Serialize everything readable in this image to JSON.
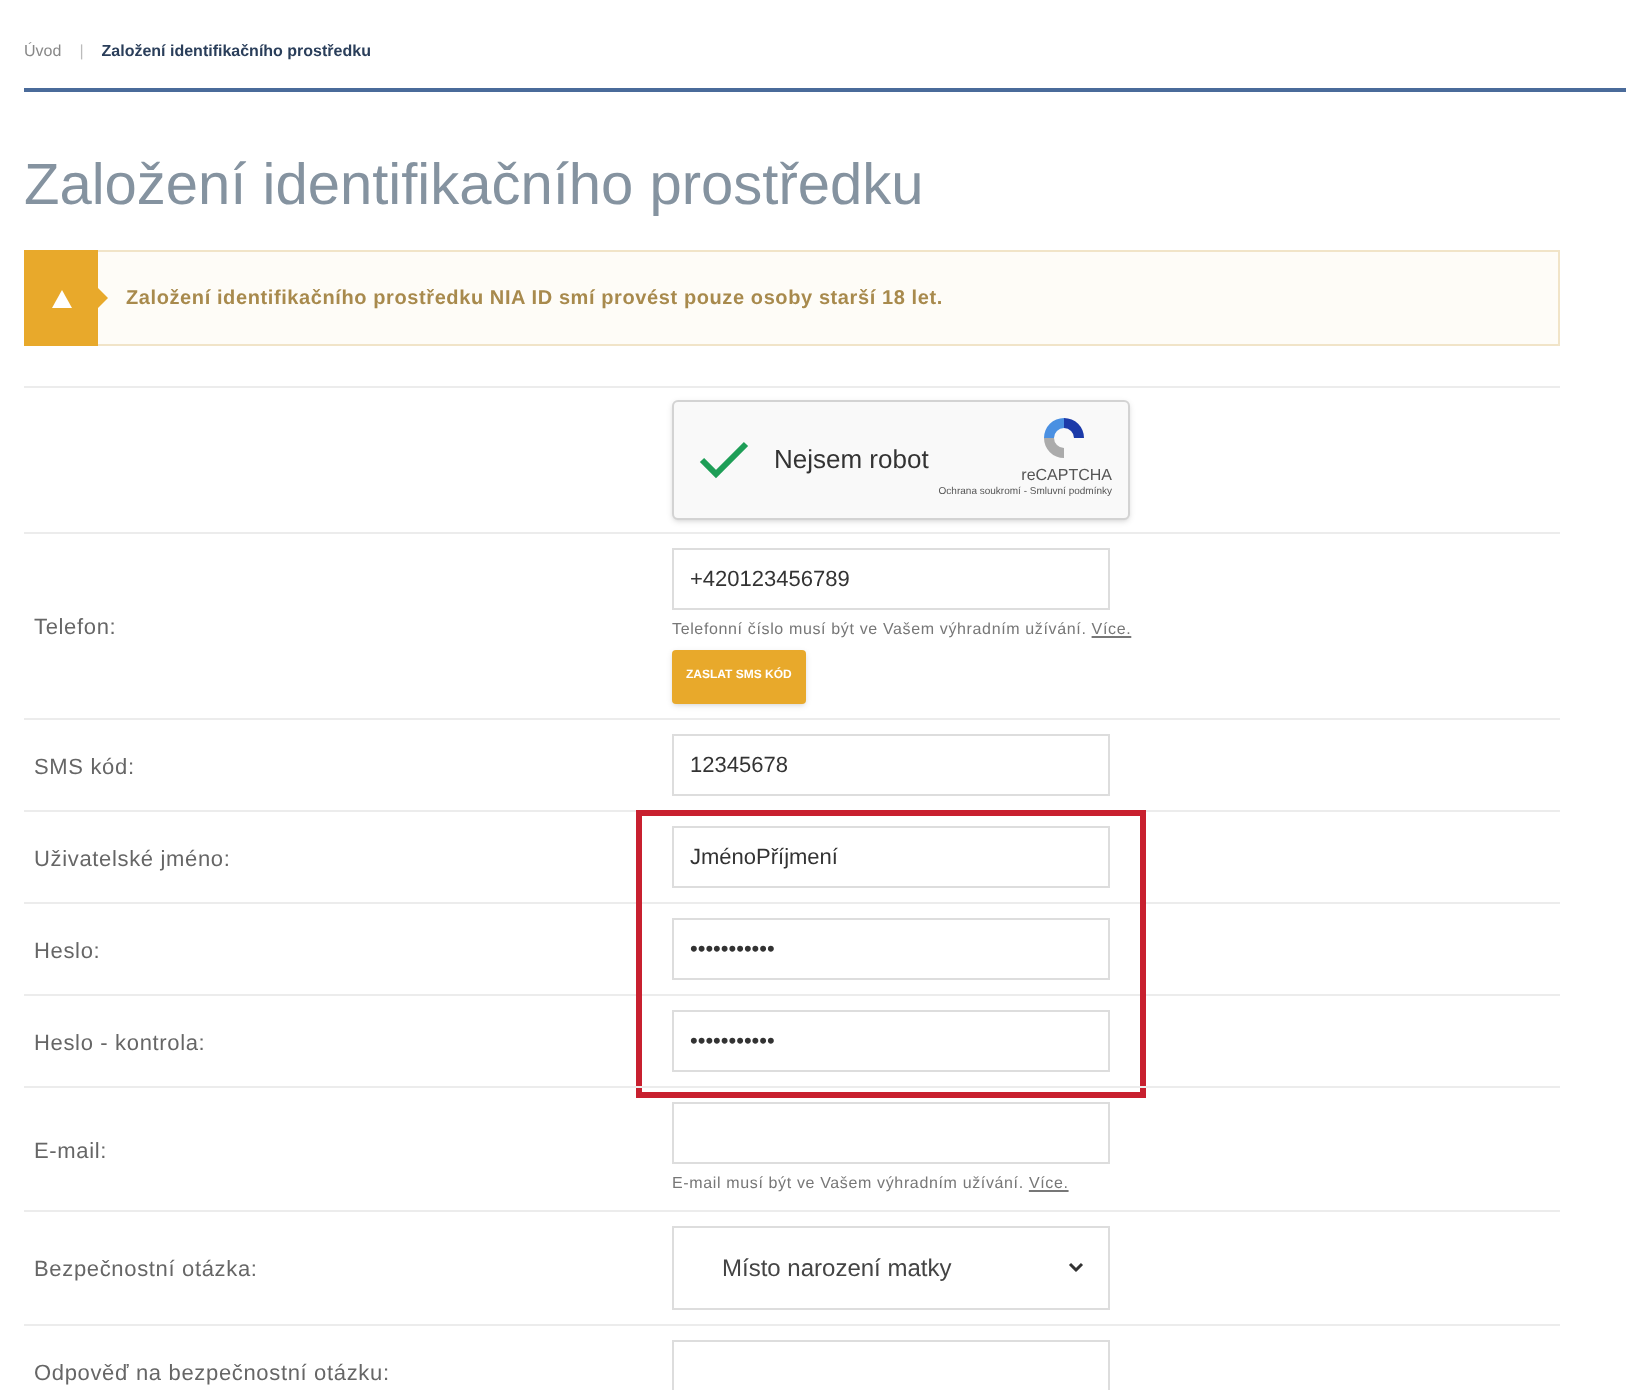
{
  "breadcrumb": [
    {
      "label": "Úvod",
      "selected": false
    },
    {
      "label": "Založení identifikačního prostředku",
      "selected": true
    }
  ],
  "breadcrumb_separator": "|",
  "title": "Založení identifikačního prostředku",
  "alert": {
    "kind": "warning",
    "text": "Založení identifikačního prostředku NIA ID smí provést pouze osoby starší 18 let."
  },
  "form": {
    "rows": [
      {
        "kind": "captcha",
        "label_text": "Nejsem robot",
        "checked": true,
        "brand": "reCAPTCHA",
        "legal": "Ochrana soukromí - Smluvní podmínky",
        "highlighted": false
      },
      {
        "kind": "text",
        "label": "Telefon:",
        "value": "+420123456789",
        "hint": "Telefonní číslo musí být ve Vašem výhradním užívání.",
        "hint_link": "Více.",
        "button": "ZASLAT SMS KÓD",
        "highlighted": false
      },
      {
        "kind": "text",
        "label": "SMS kód:",
        "value": "12345678",
        "highlighted": false
      },
      {
        "kind": "text",
        "label": "Uživatelské jméno:",
        "value": "JménoPříjmení",
        "highlighted": true
      },
      {
        "kind": "text",
        "label": "Heslo:",
        "value": "•••••••••••",
        "highlighted": true
      },
      {
        "kind": "text",
        "label": "Heslo - kontrola:",
        "value": "•••••••••••",
        "highlighted": true
      },
      {
        "kind": "text",
        "label": "E-mail:",
        "hint": "E-mail musí být ve Vašem výhradním užívání.",
        "hint_link": "Více.",
        "highlighted": false
      },
      {
        "kind": "select",
        "label": "Bezpečnostní otázka:",
        "value": "Místo narození matky",
        "highlighted": false
      },
      {
        "kind": "text",
        "label": "Odpověď na bezpečnostní otázku:",
        "highlighted": false
      }
    ]
  }
}
